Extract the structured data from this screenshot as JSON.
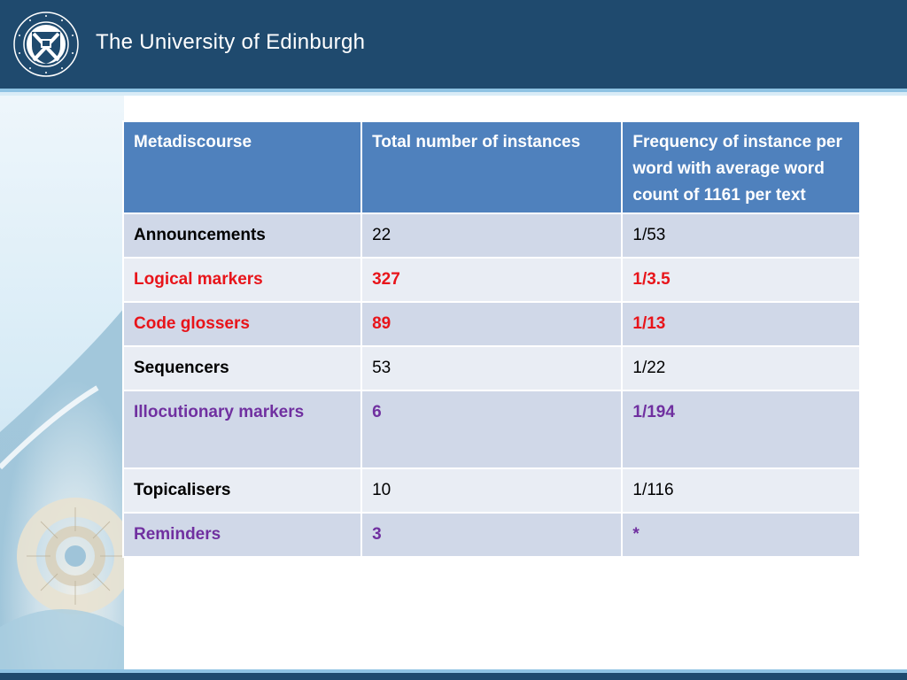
{
  "header": {
    "crest_icon": "university-crest-icon",
    "university_name": "The University of Edinburgh"
  },
  "colors": {
    "header_bg": "#1f4a6e",
    "table_header_bg": "#4f81bd",
    "row_odd_bg": "#d0d8e8",
    "row_even_bg": "#e9edf4",
    "red_text": "#e8141a",
    "purple_text": "#7030a0"
  },
  "table": {
    "headers": [
      "Metadiscourse",
      "Total number of instances",
      "Frequency of instance per word with average word count of 1161 per text"
    ],
    "rows": [
      {
        "category": "Announcements",
        "total": "22",
        "frequency": "1/53",
        "color": "black"
      },
      {
        "category": "Logical markers",
        "total": "327",
        "frequency": "1/3.5",
        "color": "red"
      },
      {
        "category": "Code glossers",
        "total": "89",
        "frequency": "1/13",
        "color": "red"
      },
      {
        "category": "Sequencers",
        "total": "53",
        "frequency": "1/22",
        "color": "black"
      },
      {
        "category": "Illocutionary markers",
        "total": "6",
        "frequency": "1/194",
        "color": "purple"
      },
      {
        "category": "Topicalisers",
        "total": "10",
        "frequency": "1/116",
        "color": "black"
      },
      {
        "category": "Reminders",
        "total": "3",
        "frequency": "*",
        "color": "purple"
      }
    ]
  }
}
